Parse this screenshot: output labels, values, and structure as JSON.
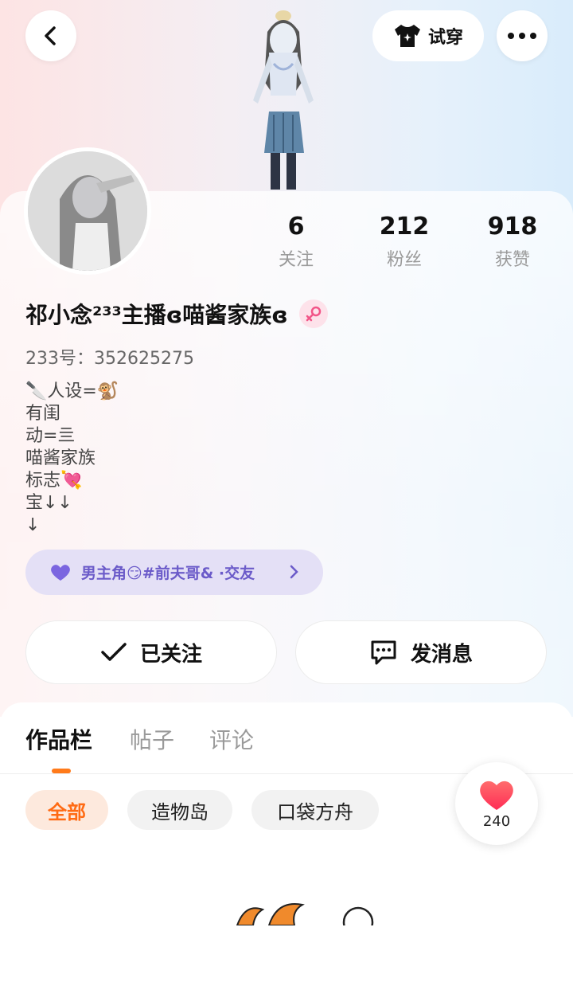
{
  "header": {
    "try_on_label": "试穿"
  },
  "stats": [
    {
      "value": "6",
      "label": "关注"
    },
    {
      "value": "212",
      "label": "粉丝"
    },
    {
      "value": "918",
      "label": "获赞"
    }
  ],
  "profile": {
    "name": "祁小念²³³主播ɞ喵酱家族ɞ",
    "uid": "233号：352625275",
    "bio_lines": [
      "🔪人设=🐒",
      "有闺",
      "动=亖",
      "喵酱家族",
      "标志💘",
      "宝↓↓",
      "↓"
    ],
    "tag": "男主角😏#前夫哥& ·交友"
  },
  "actions": {
    "follow_label": "已关注",
    "message_label": "发消息"
  },
  "tabs": [
    {
      "label": "作品栏",
      "active": true
    },
    {
      "label": "帖子",
      "active": false
    },
    {
      "label": "评论",
      "active": false
    }
  ],
  "filters": [
    {
      "label": "全部",
      "active": true
    },
    {
      "label": "造物岛",
      "active": false
    },
    {
      "label": "口袋方舟",
      "active": false
    }
  ],
  "like_count": "240",
  "colors": {
    "accent": "#ff7a1a",
    "tag_text": "#6b5bc9",
    "heart": "#ff3b4f"
  },
  "icons": [
    "back-icon",
    "tshirt-icon",
    "more-icon",
    "check-icon",
    "message-icon",
    "heart-icon",
    "female-icon",
    "chevron-right-icon"
  ]
}
